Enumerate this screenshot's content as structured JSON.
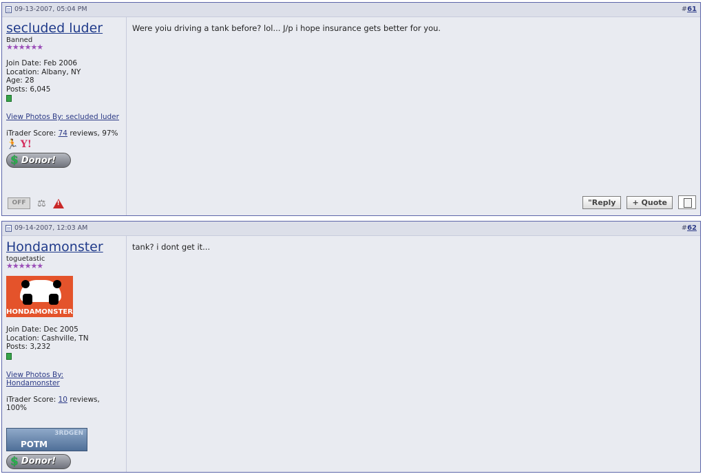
{
  "posts": [
    {
      "date": "09-13-2007, 05:04 PM",
      "number_prefix": "#",
      "number": "61",
      "username": "secluded luder",
      "user_title": "Banned",
      "stars": "★★★★★★",
      "info": {
        "join_date": "Join Date: Feb 2006",
        "location": "Location: Albany, NY",
        "age": "Age: 28",
        "posts": "Posts: 6,045"
      },
      "view_photos": "View Photos By: secluded luder",
      "itrader_prefix": "iTrader Score: ",
      "itrader_count": "74",
      "itrader_suffix": " reviews, 97%",
      "donor_label": "Donor!",
      "status_badge": "OFF",
      "message": "Were yoiu driving a tank before? lol... J/p i hope insurance gets better for you.",
      "reply_label": "\"Reply",
      "quote_label": "+ Quote"
    },
    {
      "date": "09-14-2007, 12:03 AM",
      "number_prefix": "#",
      "number": "62",
      "username": "Hondamonster",
      "user_title": "toguetastic",
      "stars": "★★★★★★",
      "avatar_text": "HONDAMONSTER",
      "info": {
        "join_date": "Join Date: Dec 2005",
        "location": "Location: Cashville, TN",
        "posts": "Posts: 3,232"
      },
      "view_photos": "View Photos By: Hondamonster",
      "itrader_prefix": "iTrader Score: ",
      "itrader_count": "10",
      "itrader_suffix": " reviews, 100%",
      "potm_top": "3RDGEN",
      "potm_label": "POTM",
      "donor_label": "Donor!",
      "message": "tank? i dont get it..."
    }
  ],
  "colors": {
    "link": "#2c3a86",
    "post_bg": "#e9ebf1",
    "header_bg": "#dcdfe9",
    "border": "#5b64a8",
    "stars": "#9b4fb8"
  }
}
